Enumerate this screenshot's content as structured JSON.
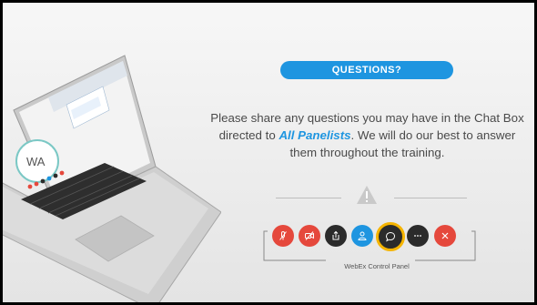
{
  "slide": {
    "heading": "QUESTIONS?",
    "body_before": "Please share any questions you may have in the Chat Box directed to ",
    "body_emphasis": "All Panelists",
    "body_after": ". We will do our best to answer them throughout the training.",
    "control_panel_label": "WebEx Control Panel"
  },
  "laptop_screen": {
    "logo_text": "WA"
  },
  "controls": [
    {
      "name": "mute-button",
      "icon": "mic-off-icon",
      "color": "#e5483c"
    },
    {
      "name": "stop-video-button",
      "icon": "video-off-icon",
      "color": "#e5483c"
    },
    {
      "name": "share-button",
      "icon": "share-icon",
      "color": "#2b2b2b"
    },
    {
      "name": "participants-button",
      "icon": "participant-icon",
      "color": "#1e95e0"
    },
    {
      "name": "chat-button",
      "icon": "chat-icon",
      "color": "#2b2b2b",
      "highlight": "#f5b400"
    },
    {
      "name": "more-button",
      "icon": "more-icon",
      "color": "#2b2b2b"
    },
    {
      "name": "leave-button",
      "icon": "close-icon",
      "color": "#e5483c"
    }
  ],
  "colors": {
    "accent": "#1e95e0",
    "danger": "#e5483c",
    "highlight": "#f5b400",
    "text": "#4a4a4a"
  }
}
